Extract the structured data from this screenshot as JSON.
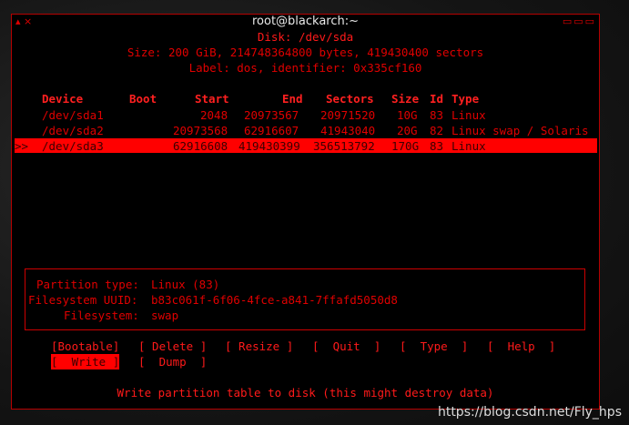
{
  "window": {
    "title": "root@blackarch:~",
    "left_controls": "▴ ×",
    "right_controls": "▭▭▭"
  },
  "disk": {
    "title": "Disk: /dev/sda",
    "size_line": "Size: 200 GiB, 214748364800 bytes, 419430400 sectors",
    "label_line": "Label: dos, identifier: 0x335cf160"
  },
  "table": {
    "headers": [
      "Device",
      "Boot",
      "Start",
      "End",
      "Sectors",
      "Size",
      "Id",
      "Type"
    ],
    "rows": [
      {
        "marker": "",
        "device": "/dev/sda1",
        "boot": "",
        "start": "2048",
        "end": "20973567",
        "sectors": "20971520",
        "size": "10G",
        "id": "83",
        "type": "Linux"
      },
      {
        "marker": "",
        "device": "/dev/sda2",
        "boot": "",
        "start": "20973568",
        "end": "62916607",
        "sectors": "41943040",
        "size": "20G",
        "id": "82",
        "type": "Linux swap / Solaris"
      },
      {
        "marker": ">>",
        "device": "/dev/sda3",
        "boot": "",
        "start": "62916608",
        "end": "419430399",
        "sectors": "356513792",
        "size": "170G",
        "id": "83",
        "type": "Linux"
      }
    ],
    "selected_index": 2
  },
  "info": {
    "partition_type_label": "Partition type:",
    "partition_type_value": "Linux (83)",
    "uuid_label": "Filesystem UUID:",
    "uuid_value": "b83c061f-6f06-4fce-a841-7ffafd5050d8",
    "fs_label": "Filesystem:",
    "fs_value": "swap"
  },
  "menu": {
    "bootable": "[Bootable]",
    "delete": "[ Delete ]",
    "resize": "[ Resize ]",
    "quit": "[  Quit  ]",
    "type": "[  Type  ]",
    "help": "[  Help  ]",
    "write": "[  Write ]",
    "dump": "[  Dump  ]",
    "selected": "write"
  },
  "status": "Write partition table to disk (this might destroy data)",
  "watermark": "https://blog.csdn.net/Fly_hps",
  "colors": {
    "accent": "#ff0000",
    "background": "#000000",
    "border": "#b50000"
  }
}
